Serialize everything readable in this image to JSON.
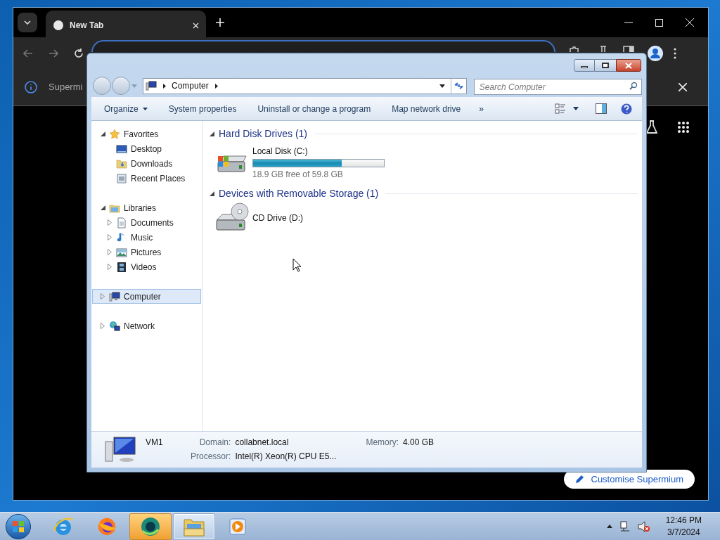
{
  "browser": {
    "tab": {
      "title": "New Tab"
    },
    "infobar": {
      "text": "Supermi"
    },
    "customise_button": {
      "label": "Customise Supermium"
    }
  },
  "explorer": {
    "address": {
      "segments": [
        "Computer"
      ]
    },
    "search": {
      "placeholder": "Search Computer"
    },
    "toolbar": [
      {
        "label": "Organize",
        "dropdown": true
      },
      {
        "label": "System properties",
        "dropdown": false
      },
      {
        "label": "Uninstall or change a program",
        "dropdown": false
      },
      {
        "label": "Map network drive",
        "dropdown": false
      }
    ],
    "toolbar_overflow": "»",
    "nav": [
      {
        "label": "Favorites",
        "kind": "favorites",
        "expanded": true,
        "selected": false,
        "children": [
          {
            "label": "Desktop",
            "kind": "desktop",
            "selected": false
          },
          {
            "label": "Downloads",
            "kind": "downloads",
            "selected": false
          },
          {
            "label": "Recent Places",
            "kind": "recent",
            "selected": false
          }
        ]
      },
      {
        "label": "Libraries",
        "kind": "libraries",
        "expanded": true,
        "selected": false,
        "children": [
          {
            "label": "Documents",
            "kind": "documents",
            "expanded": false,
            "selected": false
          },
          {
            "label": "Music",
            "kind": "music",
            "expanded": false,
            "selected": false
          },
          {
            "label": "Pictures",
            "kind": "pictures",
            "expanded": false,
            "selected": false
          },
          {
            "label": "Videos",
            "kind": "videos",
            "expanded": false,
            "selected": false
          }
        ]
      },
      {
        "label": "Computer",
        "kind": "computer",
        "expanded": false,
        "selected": true
      },
      {
        "label": "Network",
        "kind": "network",
        "expanded": false,
        "selected": false
      }
    ],
    "groups": [
      {
        "title": "Hard Disk Drives (1)",
        "expanded": true,
        "items": [
          {
            "kind": "hard_disk",
            "name": "Local Disk (C:)",
            "level": 0.68,
            "space": "18.9 GB free of 59.8 GB"
          }
        ]
      },
      {
        "title": "Devices with Removable Storage (1)",
        "expanded": true,
        "items": [
          {
            "kind": "cd_drive",
            "name": "CD Drive (D:)"
          }
        ]
      }
    ],
    "details": {
      "name": "VM1",
      "fields": [
        {
          "label": "Domain:",
          "value": "collabnet.local"
        },
        {
          "label": "Memory:",
          "value": "4.00 GB"
        },
        {
          "label": "Processor:",
          "value": "Intel(R) Xeon(R) CPU E5..."
        }
      ]
    }
  },
  "taskbar": {
    "apps": [
      {
        "kind": "ie",
        "selected": false,
        "flashing": false
      },
      {
        "kind": "firefox",
        "selected": false,
        "flashing": false
      },
      {
        "kind": "supermium",
        "selected": false,
        "flashing": true
      },
      {
        "kind": "explorer",
        "selected": true,
        "flashing": false
      },
      {
        "kind": "media_player",
        "selected": false,
        "flashing": false
      }
    ],
    "tray": {
      "volume_muted": true
    },
    "clock": {
      "time": "12:46 PM",
      "date": "3/7/2024"
    }
  }
}
